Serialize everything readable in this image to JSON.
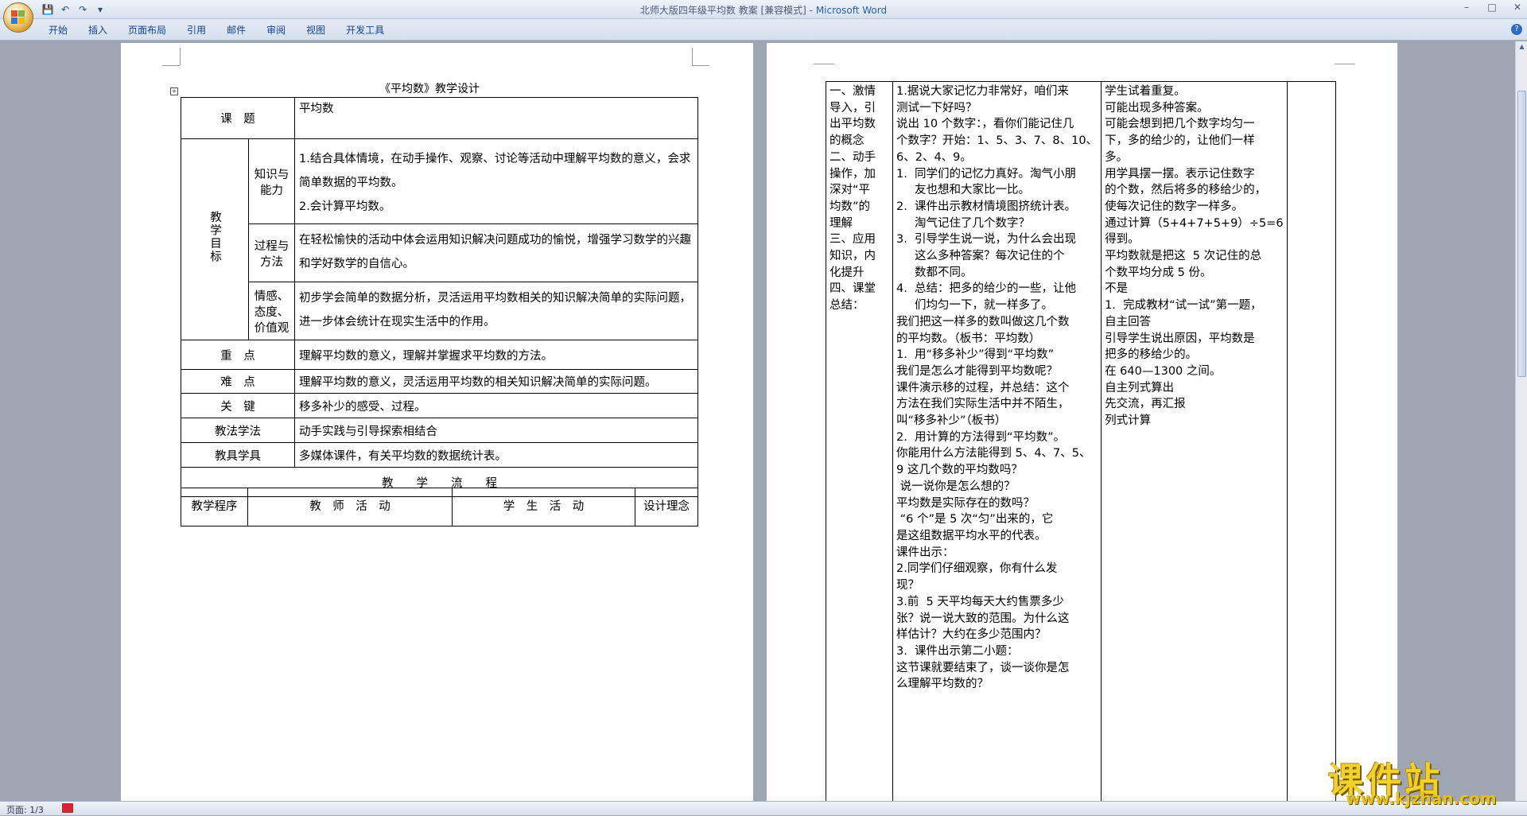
{
  "window": {
    "title": "北师大版四年级平均数 教案 [兼容模式] - Microsoft Word",
    "title_doc": "北师大版四年级平均数 教案 [兼容模式] - ",
    "title_app": "Microsoft Word"
  },
  "qat": {
    "save": "💾",
    "undo": "↶",
    "redo": "↷",
    "more": "▾"
  },
  "winctl": {
    "min": "–",
    "max": "□",
    "close": "✕"
  },
  "tabs": [
    "开始",
    "插入",
    "页面布局",
    "引用",
    "邮件",
    "审阅",
    "视图",
    "开发工具"
  ],
  "status": {
    "page": "页面: 1/3"
  },
  "page1": {
    "heading": "《平均数》教学设计",
    "course_label": "课　题",
    "course_value": "平均数",
    "objectives_label": "教学目标",
    "obj": [
      {
        "label": "知识与能力",
        "lines": [
          "1.结合具体情境，在动手操作、观察、讨论等活动中理解平均数的意义，会求简单数据的平均数。",
          "2.会计算平均数。"
        ]
      },
      {
        "label": "过程与方法",
        "lines": [
          "在轻松愉快的活动中体会运用知识解决问题成功的愉悦，增强学习数学的兴趣和学好数学的自信心。"
        ]
      },
      {
        "label": "情感、态度、价值观",
        "lines": [
          "初步学会简单的数据分析，灵活运用平均数相关的知识解决简单的实际问题，进一步体会统计在现实生活中的作用。"
        ]
      }
    ],
    "rows": [
      {
        "label": "重　点",
        "value": "理解平均数的意义，理解并掌握求平均数的方法。"
      },
      {
        "label": "难　点",
        "value": "理解平均数的意义，灵活运用平均数的相关知识解决简单的实际问题。"
      },
      {
        "label": "关　键",
        "value": "移多补少的感受、过程。"
      },
      {
        "label": "教法学法",
        "value": "动手实践与引导探索相结合"
      },
      {
        "label": "教具学具",
        "value": "多媒体课件，有关平均数的数据统计表。"
      }
    ],
    "flow_title": "教　　学　　流　　程",
    "flow_headers": [
      "教学程序",
      "教　师　活　动",
      "学　生　活　动",
      "设计理念"
    ]
  },
  "page2": {
    "col1": [
      "一、激情",
      "导入，引",
      "出平均数",
      "的概念",
      "",
      "",
      "",
      "",
      "",
      "",
      "",
      "",
      "",
      "",
      "",
      "",
      "二、动手",
      "操作，加",
      "深对“平",
      "均数”的",
      "理解",
      "",
      "",
      "",
      "",
      "",
      "",
      "",
      "",
      "",
      "",
      "三、应用",
      "知识，内",
      "化提升",
      "",
      "",
      "四、课堂",
      "总结："
    ],
    "col2": [
      "1.据说大家记忆力非常好，咱们来",
      "测试一下好吗？",
      "说出 10 个数字：，看你们能记住几",
      "个数字？开始：1、5、3、7、8、10、",
      "6、2、4、9。",
      "1.  同学们的记忆力真好。淘气小朋",
      "     友也想和大家比一比。",
      "2.  课件出示教材情境图挤统计表。",
      "     淘气记住了几个数字？",
      "3.  引导学生说一说，为什么会出现",
      "     这么多种答案？每次记住的个",
      "     数都不同。",
      "4.  总结：把多的给少的一些，让他",
      "     们均匀一下，就一样多了。",
      "我们把这一样多的数叫做这几个数",
      "的平均数。（板书：平均数）",
      "1.  用“移多补少”得到“平均数”",
      "我们是怎么才能得到平均数呢？",
      "",
      "课件演示移的过程，并总结：这个",
      "方法在我们实际生活中并不陌生，",
      "叫“移多补少”（板书）",
      "2.  用计算的方法得到“平均数”。",
      "你能用什么方法能得到 5、4、7、5、",
      "9 这几个数的平均数吗？",
      " 说一说你是怎么想的？",
      "",
      "平均数是实际存在的数吗？",
      " “6 个”是 5 次“匀”出来的，它",
      "是这组数据平均水平的代表。",
      "课件出示：",
      "2.同学们仔细观察，你有什么发",
      "现？",
      "3.前  5 天平均每天大约售票多少",
      "张？说一说大致的范围。为什么这",
      "样估计？大约在多少范围内？",
      "",
      "3.  课件出示第二小题：",
      "这节课就要结束了，谈一谈你是怎",
      "么理解平均数的？"
    ],
    "col3": [
      "",
      "",
      "",
      "",
      "学生试着重复。",
      "",
      "",
      "",
      "",
      "可能出现多种答案。",
      "可能会想到把几个数字均匀一",
      "下，多的给少的，让他们一样",
      "多。",
      "",
      "",
      "",
      "",
      "",
      "",
      "用学具摆一摆。表示记住数字",
      "的个数，然后将多的移给少的，",
      "使每次记住的数字一样多。",
      "",
      "",
      "",
      "",
      "通过计算（5+4+7+5+9）÷5=6",
      "得到。",
      "",
      "平均数就是把这  5 次记住的总",
      "个数平均分成 5 份。",
      "不是",
      "",
      "",
      "1.  完成教材“试一试”第一题，",
      "自主回答",
      "",
      "引导学生说出原因，平均数是",
      "把多的移给少的。",
      "在 640—1300 之间。",
      "自主列式算出",
      "",
      "先交流，再汇报",
      "列式计算"
    ]
  },
  "watermark": {
    "brand": "课件站",
    "url": "www.kjzhan.com"
  }
}
